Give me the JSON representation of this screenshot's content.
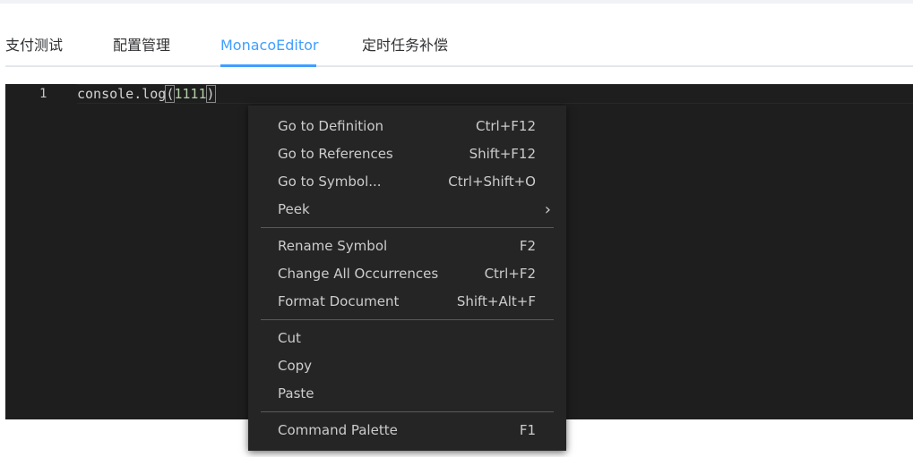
{
  "tabs": [
    {
      "label": "支付测试",
      "active": false
    },
    {
      "label": "配置管理",
      "active": false
    },
    {
      "label": "MonacoEditor",
      "active": true
    },
    {
      "label": "定时任务补偿",
      "active": false
    }
  ],
  "editor": {
    "line_number": "1",
    "code": {
      "prefix": "console.log",
      "open_paren": "(",
      "number": "1111",
      "close_paren": ")"
    }
  },
  "context_menu": {
    "groups": [
      [
        {
          "label": "Go to Definition",
          "shortcut": "Ctrl+F12"
        },
        {
          "label": "Go to References",
          "shortcut": "Shift+F12"
        },
        {
          "label": "Go to Symbol...",
          "shortcut": "Ctrl+Shift+O"
        },
        {
          "label": "Peek",
          "submenu_icon": "chevron-right-icon"
        }
      ],
      [
        {
          "label": "Rename Symbol",
          "shortcut": "F2"
        },
        {
          "label": "Change All Occurrences",
          "shortcut": "Ctrl+F2"
        },
        {
          "label": "Format Document",
          "shortcut": "Shift+Alt+F"
        }
      ],
      [
        {
          "label": "Cut"
        },
        {
          "label": "Copy"
        },
        {
          "label": "Paste"
        }
      ],
      [
        {
          "label": "Command Palette",
          "shortcut": "F1"
        }
      ]
    ]
  },
  "colors": {
    "accent": "#409eff",
    "editor_bg": "#1e1e1e",
    "menu_bg": "#252526"
  }
}
